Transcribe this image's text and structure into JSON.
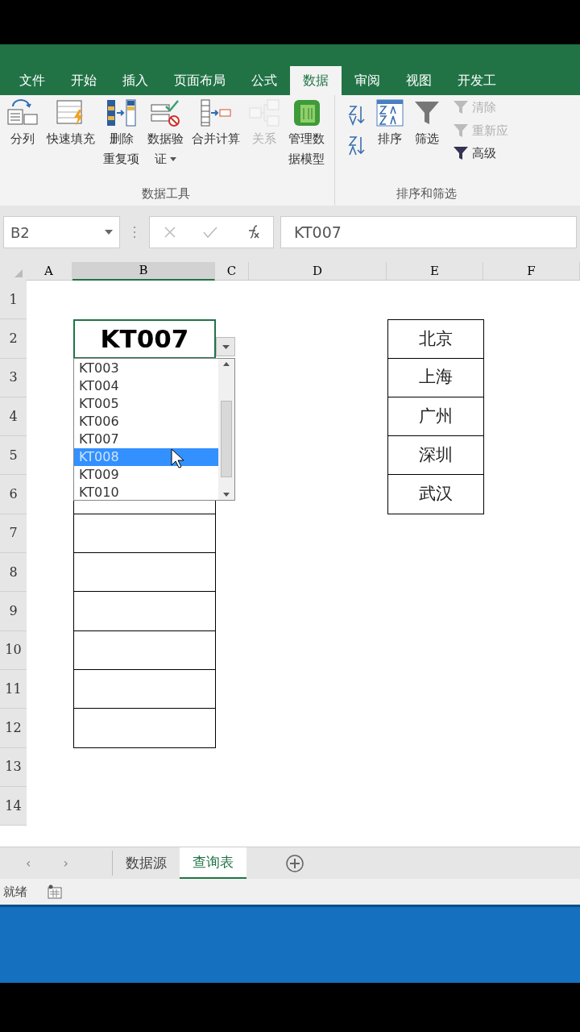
{
  "ribbon_tabs": [
    {
      "label": "文件",
      "selected": false
    },
    {
      "label": "开始",
      "selected": false
    },
    {
      "label": "插入",
      "selected": false
    },
    {
      "label": "页面布局",
      "selected": false
    },
    {
      "label": "公式",
      "selected": false
    },
    {
      "label": "数据",
      "selected": true
    },
    {
      "label": "审阅",
      "selected": false
    },
    {
      "label": "视图",
      "selected": false
    },
    {
      "label": "开发工",
      "selected": false
    }
  ],
  "ribbon_groups": [
    {
      "label": "数据工具",
      "buttons": [
        {
          "kind": "large",
          "lines": [
            "分列"
          ],
          "disabled": false
        },
        {
          "kind": "large",
          "lines": [
            "快速填充"
          ],
          "disabled": false
        },
        {
          "kind": "large",
          "lines": [
            "删除",
            "重复项"
          ],
          "disabled": false
        },
        {
          "kind": "large",
          "lines": [
            "数据验",
            "证"
          ],
          "disabled": false,
          "dropdown": true
        },
        {
          "kind": "large",
          "lines": [
            "合并计算"
          ],
          "disabled": false
        },
        {
          "kind": "large",
          "lines": [
            "关系"
          ],
          "disabled": true
        },
        {
          "kind": "large",
          "lines": [
            "管理数",
            "据模型"
          ],
          "disabled": false
        }
      ]
    },
    {
      "label": "排序和筛选",
      "buttons": [
        {
          "kind": "sortpair"
        },
        {
          "kind": "large",
          "lines": [
            "排序"
          ],
          "disabled": false
        },
        {
          "kind": "large",
          "lines": [
            "筛选"
          ],
          "disabled": false
        },
        {
          "kind": "smallstack",
          "items": [
            {
              "label": "清除",
              "disabled": true
            },
            {
              "label": "重新应",
              "disabled": true
            },
            {
              "label": "高级",
              "disabled": false
            }
          ]
        }
      ]
    }
  ],
  "sheet_nav": [
    "‹",
    "›"
  ],
  "name_box": "B2",
  "formula": "KT007",
  "columns": [
    {
      "label": "A",
      "selected": false
    },
    {
      "label": "B",
      "selected": true
    },
    {
      "label": "C",
      "selected": false
    },
    {
      "label": "D",
      "selected": false
    },
    {
      "label": "E",
      "selected": false
    },
    {
      "label": "F",
      "selected": false
    }
  ],
  "rows": [
    "1",
    "2",
    "3",
    "4",
    "5",
    "6",
    "7",
    "8",
    "9",
    "10",
    "11",
    "12",
    "13",
    "14"
  ],
  "active_cell": {
    "value": "KT007"
  },
  "city_cells": [
    "北京",
    "上海",
    "广州",
    "深圳",
    "武汉"
  ],
  "dropdown": {
    "items": [
      {
        "label": "KT003",
        "selected": false
      },
      {
        "label": "KT004",
        "selected": false
      },
      {
        "label": "KT005",
        "selected": false
      },
      {
        "label": "KT006",
        "selected": false
      },
      {
        "label": "KT007",
        "selected": false
      },
      {
        "label": "KT008",
        "selected": true
      },
      {
        "label": "KT009",
        "selected": false
      },
      {
        "label": "KT010",
        "selected": false
      }
    ]
  },
  "sheet_tabs": [
    {
      "label": "数据源",
      "selected": false
    },
    {
      "label": "查询表",
      "selected": true
    }
  ],
  "status_bar": {
    "text": "就绪"
  }
}
